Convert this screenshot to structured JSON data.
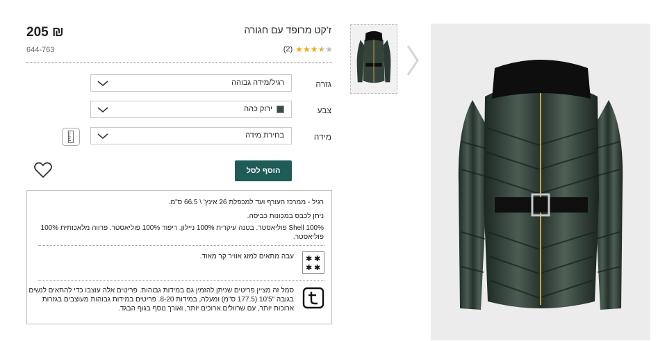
{
  "product": {
    "title": "ז'קט מרופד עם חגורה",
    "price": "205 ₪",
    "sku": "644-763",
    "rating_count": "(2)",
    "rating_value": 3.5,
    "rating_max": 5
  },
  "options": {
    "fit_label": "גזרה",
    "fit_value": "רגיל/מידה גבוהה",
    "color_label": "צבע",
    "color_value": "ירוק כהה",
    "color_swatch": "#3d4b44",
    "size_label": "מידה",
    "size_value": "בחירת מידה"
  },
  "actions": {
    "add_to_bag": "הוסף לסל"
  },
  "details": {
    "fit_note": "רגיל - ממרכז העורף ועד למכפלת 26 אינץ' \\ 66.5 ס\"מ.",
    "wash_note": "ניתן לכבס במכונות כביסה.",
    "composition": "Shell 100% פוליאסטר. בטנה עיקרית 100% ניילון. ריפוד 100% פוליאסטר. פרווה מלאכותית 100% פוליאסטר.",
    "warmth_note": "עבה מתאים למזג אוויר קר מאוד.",
    "tall_note": "סמל זה מציין פריטים שניתן להזמין גם במידות גבוהות. פריטים אלה עוצבו כדי להתאים לנשים בגובה \"5'10 (177.5 ס\"מ) ומעלה, במידות 8-20. פריטים במידות גבוהות מעוצבים בגזרות ארוכות יותר, עם שרוולים ארוכים יותר, ואורך נוסף בגוף הבגד."
  },
  "icons": {
    "favorite": "heart-icon",
    "size_guide": "ruler-icon",
    "warmth": "snowflake-icon",
    "tall": "tall-t-icon",
    "carousel": "chevron-right-icon"
  },
  "colors": {
    "accent": "#1f5c55",
    "star": "#f2a900",
    "jacket": "#2c3a33"
  }
}
